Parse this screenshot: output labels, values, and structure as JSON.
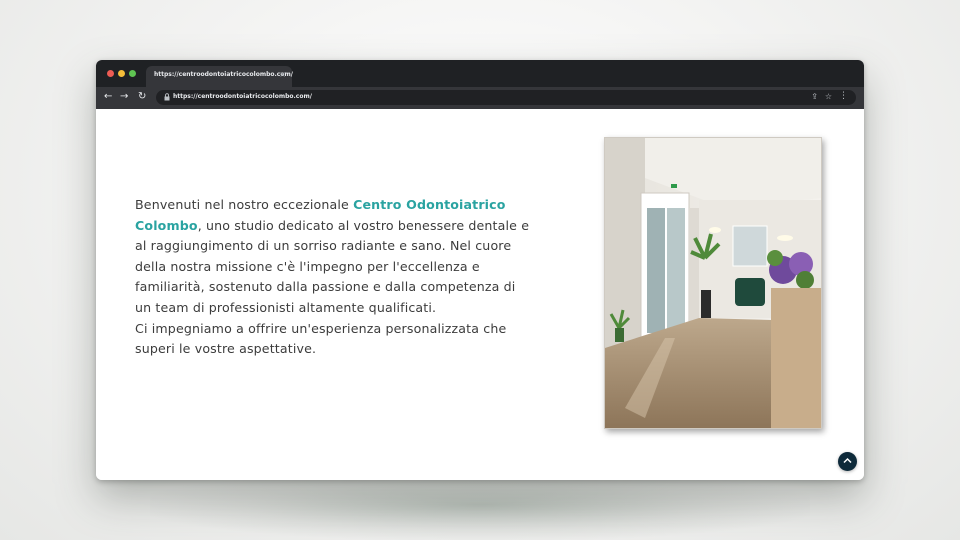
{
  "browser": {
    "tab_title": "https://centroodontoiatricocolombo.com/",
    "tab_close_glyph": "×",
    "url": "https://centroodontoiatricocolombo.com/",
    "icons": {
      "back": "arrow-left-icon",
      "forward": "arrow-right-icon",
      "reload": "reload-icon",
      "lock": "lock-icon",
      "share": "share-icon",
      "star": "star-icon",
      "menu": "kebab-menu-icon"
    },
    "glyphs": {
      "back": "←",
      "forward": "→",
      "reload": "↻",
      "lock": "🔒",
      "share": "⇪",
      "star": "☆",
      "menu": "⋮"
    }
  },
  "page": {
    "intro": {
      "before_brand": "Benvenuti nel nostro eccezionale ",
      "brand": "Centro Odontoiatrico Colombo",
      "after_brand": ", uno studio dedicato al vostro benessere dentale e al raggiungimento di un sorriso radiante e sano. Nel cuore della nostra missione c'è l'impegno per l'eccellenza e familiarità, sostenuto dalla passione e dalla competenza di un team di professionisti altamente qualificati.",
      "second_line": "Ci impegniamo a offrire un'esperienza personalizzata che superi le vostre aspettative."
    },
    "scroll_top_glyph": "^"
  },
  "colors": {
    "brand_teal": "#2aa3a1",
    "body_text": "#3c3c3c",
    "scroll_button": "#0e2a3a"
  }
}
